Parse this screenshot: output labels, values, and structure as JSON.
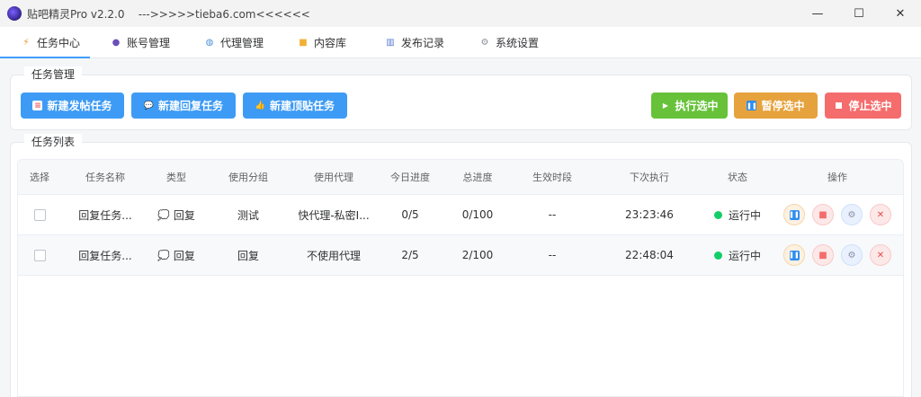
{
  "window": {
    "title": "贴吧精灵Pro v2.2.0    --->>>>>tieba6.com<<<<<<",
    "min_glyph": "—",
    "max_glyph": "☐",
    "close_glyph": "✕"
  },
  "tabs": [
    {
      "label": "任务中心",
      "icon": "lightning-icon",
      "active": true
    },
    {
      "label": "账号管理",
      "icon": "users-icon"
    },
    {
      "label": "代理管理",
      "icon": "globe-icon"
    },
    {
      "label": "内容库",
      "icon": "folder-icon"
    },
    {
      "label": "发布记录",
      "icon": "bar-chart-icon"
    },
    {
      "label": "系统设置",
      "icon": "gear-icon"
    }
  ],
  "task_management": {
    "legend": "任务管理",
    "new_post": "新建发帖任务",
    "new_reply": "新建回复任务",
    "new_bump": "新建顶贴任务",
    "run_selected": "执行选中",
    "pause_selected": "暂停选中",
    "stop_selected": "停止选中"
  },
  "task_list": {
    "legend": "任务列表",
    "columns": [
      "选择",
      "任务名称",
      "类型",
      "使用分组",
      "使用代理",
      "今日进度",
      "总进度",
      "生效时段",
      "下次执行",
      "状态",
      "操作"
    ],
    "rows": [
      {
        "name": "回复任务...",
        "type": "回复",
        "group": "测试",
        "proxy": "快代理-私密I...",
        "today": "0/5",
        "total": "0/100",
        "period": "--",
        "next": "23:23:46",
        "status": "运行中"
      },
      {
        "name": "回复任务...",
        "type": "回复",
        "group": "回复",
        "proxy": "不使用代理",
        "today": "2/5",
        "total": "2/100",
        "period": "--",
        "next": "22:48:04",
        "status": "运行中"
      }
    ]
  },
  "colors": {
    "accent": "#409eff",
    "blue_button": "#3d9bf5",
    "green_button": "#67c23a",
    "orange_button": "#e6a23c",
    "red_button": "#f56c6c",
    "status_running": "#13ce66"
  }
}
